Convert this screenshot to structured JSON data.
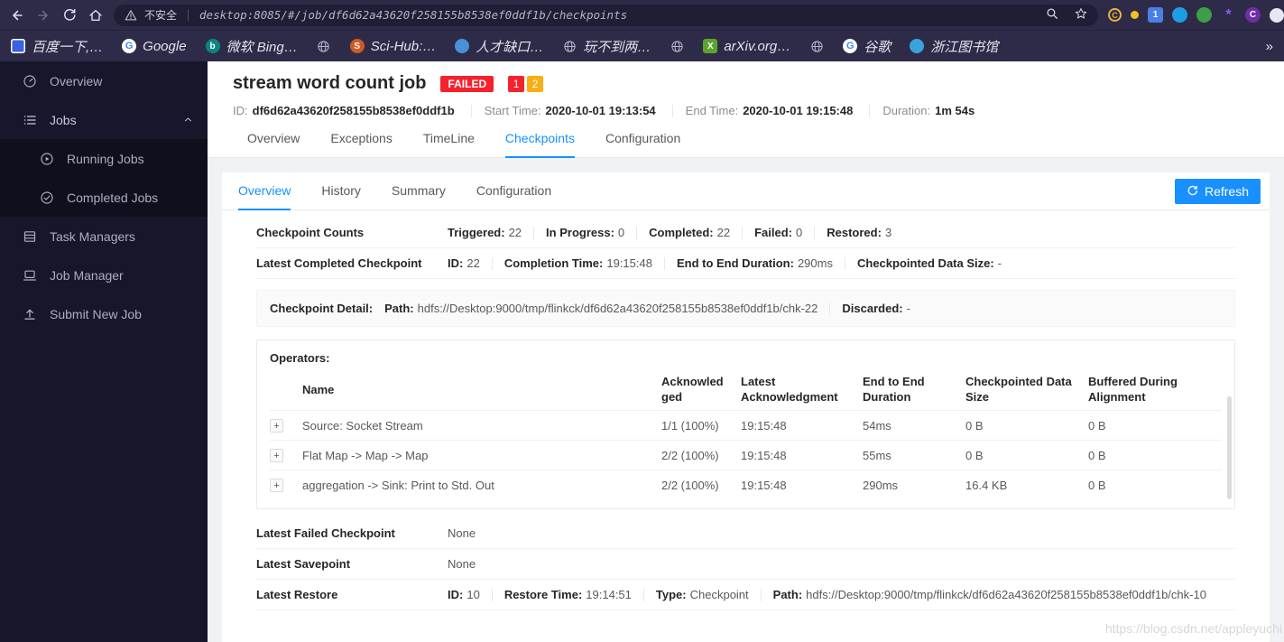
{
  "colors": {
    "accent": "#1890ff",
    "failed": "#f5222d",
    "warning": "#faad14",
    "chrome_bar": "#2e2b48",
    "sidebar": "#17172b"
  },
  "browser": {
    "security_label": "不安全",
    "url": "desktop:8085/#/job/df6d62a43620f258155b8538ef0ddf1b/checkpoints",
    "overflow_icon": "»",
    "extensions": [
      {
        "name": "extension-c",
        "glyph": "C",
        "color": "#e8b33c"
      },
      {
        "name": "yellow-dot",
        "glyph": "",
        "color": "#f3c01d"
      },
      {
        "name": "blue-tile",
        "glyph": "1",
        "color": "#4a7fe8"
      },
      {
        "name": "blue-circle",
        "glyph": "",
        "color": "#1e9de6"
      },
      {
        "name": "green-circle",
        "glyph": "",
        "color": "#3c9e46"
      },
      {
        "name": "purple-flower",
        "glyph": "*",
        "color": "#8a5cf5"
      },
      {
        "name": "profile-c",
        "glyph": "C",
        "color": "#6f2da8"
      }
    ],
    "bookmarks": [
      {
        "label": "百度一下,…",
        "glyph": ""
      },
      {
        "label": "Google",
        "glyph": "G"
      },
      {
        "label": "微软 Bing…",
        "glyph": "b"
      },
      {
        "label": "",
        "glyph": ""
      },
      {
        "label": "Sci-Hub:…",
        "glyph": "S"
      },
      {
        "label": "人才缺口…",
        "glyph": ""
      },
      {
        "label": "玩不到两…",
        "glyph": ""
      },
      {
        "label": "",
        "glyph": ""
      },
      {
        "label": "arXiv.org…",
        "glyph": "X"
      },
      {
        "label": "",
        "glyph": ""
      },
      {
        "label": "谷歌",
        "glyph": "G"
      },
      {
        "label": "浙江图书馆",
        "glyph": ""
      }
    ]
  },
  "sidebar": {
    "items": [
      {
        "label": "Overview"
      },
      {
        "label": "Jobs",
        "expanded": true,
        "children": [
          {
            "label": "Running Jobs"
          },
          {
            "label": "Completed Jobs"
          }
        ]
      },
      {
        "label": "Task Managers"
      },
      {
        "label": "Job Manager"
      },
      {
        "label": "Submit New Job"
      }
    ]
  },
  "job": {
    "title": "stream word count job",
    "status": "FAILED",
    "badges": [
      {
        "text": "1",
        "color": "#f5222d"
      },
      {
        "text": "2",
        "color": "#faad14"
      }
    ],
    "meta": [
      {
        "label": "ID:",
        "value": "df6d62a43620f258155b8538ef0ddf1b"
      },
      {
        "label": "Start Time:",
        "value": "2020-10-01 19:13:54"
      },
      {
        "label": "End Time:",
        "value": "2020-10-01 19:15:48"
      },
      {
        "label": "Duration:",
        "value": "1m 54s"
      }
    ],
    "tabs": [
      "Overview",
      "Exceptions",
      "TimeLine",
      "Checkpoints",
      "Configuration"
    ],
    "active_tab": "Checkpoints"
  },
  "checkpoints": {
    "subtabs": [
      "Overview",
      "History",
      "Summary",
      "Configuration"
    ],
    "active_subtab": "Overview",
    "refresh_label": "Refresh",
    "counts": {
      "label": "Checkpoint Counts",
      "items": [
        {
          "label": "Triggered:",
          "value": "22"
        },
        {
          "label": "In Progress:",
          "value": "0"
        },
        {
          "label": "Completed:",
          "value": "22"
        },
        {
          "label": "Failed:",
          "value": "0"
        },
        {
          "label": "Restored:",
          "value": "3"
        }
      ]
    },
    "latest_completed": {
      "label": "Latest Completed Checkpoint",
      "items": [
        {
          "label": "ID:",
          "value": "22"
        },
        {
          "label": "Completion Time:",
          "value": "19:15:48"
        },
        {
          "label": "End to End Duration:",
          "value": "290ms"
        },
        {
          "label": "Checkpointed Data Size:",
          "value": "-"
        }
      ]
    },
    "detail": {
      "label": "Checkpoint Detail:",
      "path_label": "Path:",
      "path": "hdfs://Desktop:9000/tmp/flinkck/df6d62a43620f258155b8538ef0ddf1b/chk-22",
      "discarded_label": "Discarded:",
      "discarded": "-"
    },
    "operators": {
      "title": "Operators:",
      "expand_label": "+",
      "columns": [
        "Name",
        "Acknowledged",
        "Latest Acknowledgment",
        "End to End Duration",
        "Checkpointed Data Size",
        "Buffered During Alignment"
      ],
      "rows": [
        {
          "name": "Source: Socket Stream",
          "acknowledged": "1/1 (100%)",
          "latest_ack": "19:15:48",
          "duration": "54ms",
          "data_size": "0 B",
          "buffered": "0 B"
        },
        {
          "name": "Flat Map -> Map -> Map",
          "acknowledged": "2/2 (100%)",
          "latest_ack": "19:15:48",
          "duration": "55ms",
          "data_size": "0 B",
          "buffered": "0 B"
        },
        {
          "name": "aggregation -> Sink: Print to Std. Out",
          "acknowledged": "2/2 (100%)",
          "latest_ack": "19:15:48",
          "duration": "290ms",
          "data_size": "16.4 KB",
          "buffered": "0 B"
        }
      ]
    },
    "latest_failed": {
      "label": "Latest Failed Checkpoint",
      "value": "None"
    },
    "latest_savepoint": {
      "label": "Latest Savepoint",
      "value": "None"
    },
    "latest_restore": {
      "label": "Latest Restore",
      "items": [
        {
          "label": "ID:",
          "value": "10"
        },
        {
          "label": "Restore Time:",
          "value": "19:14:51"
        },
        {
          "label": "Type:",
          "value": "Checkpoint"
        },
        {
          "label": "Path:",
          "value": "hdfs://Desktop:9000/tmp/flinkck/df6d62a43620f258155b8538ef0ddf1b/chk-10"
        }
      ]
    }
  },
  "watermark": "https://blog.csdn.net/appleyuchi"
}
